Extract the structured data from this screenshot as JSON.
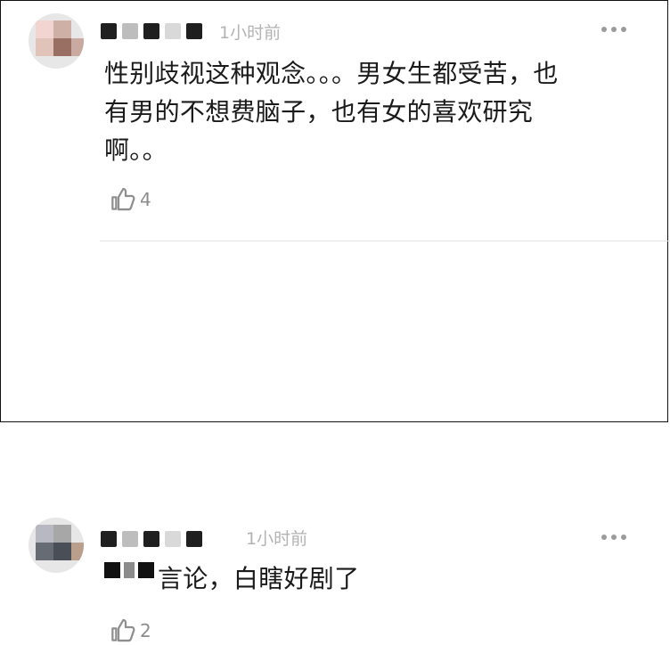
{
  "comments": [
    {
      "time": "1小时前",
      "content": "性别歧视这种观念。。。男女生都受苦，也\n有男的不想费脑子，也有女的喜欢研究\n啊。。",
      "likes": "4",
      "more_icon": "more-icon",
      "like_icon": "thumbs-up-outline-icon"
    },
    {
      "time": "1小时前",
      "content": "言论，白瞎好剧了",
      "likes": "2",
      "more_icon": "more-icon",
      "like_icon": "thumbs-up-outline-icon"
    }
  ]
}
